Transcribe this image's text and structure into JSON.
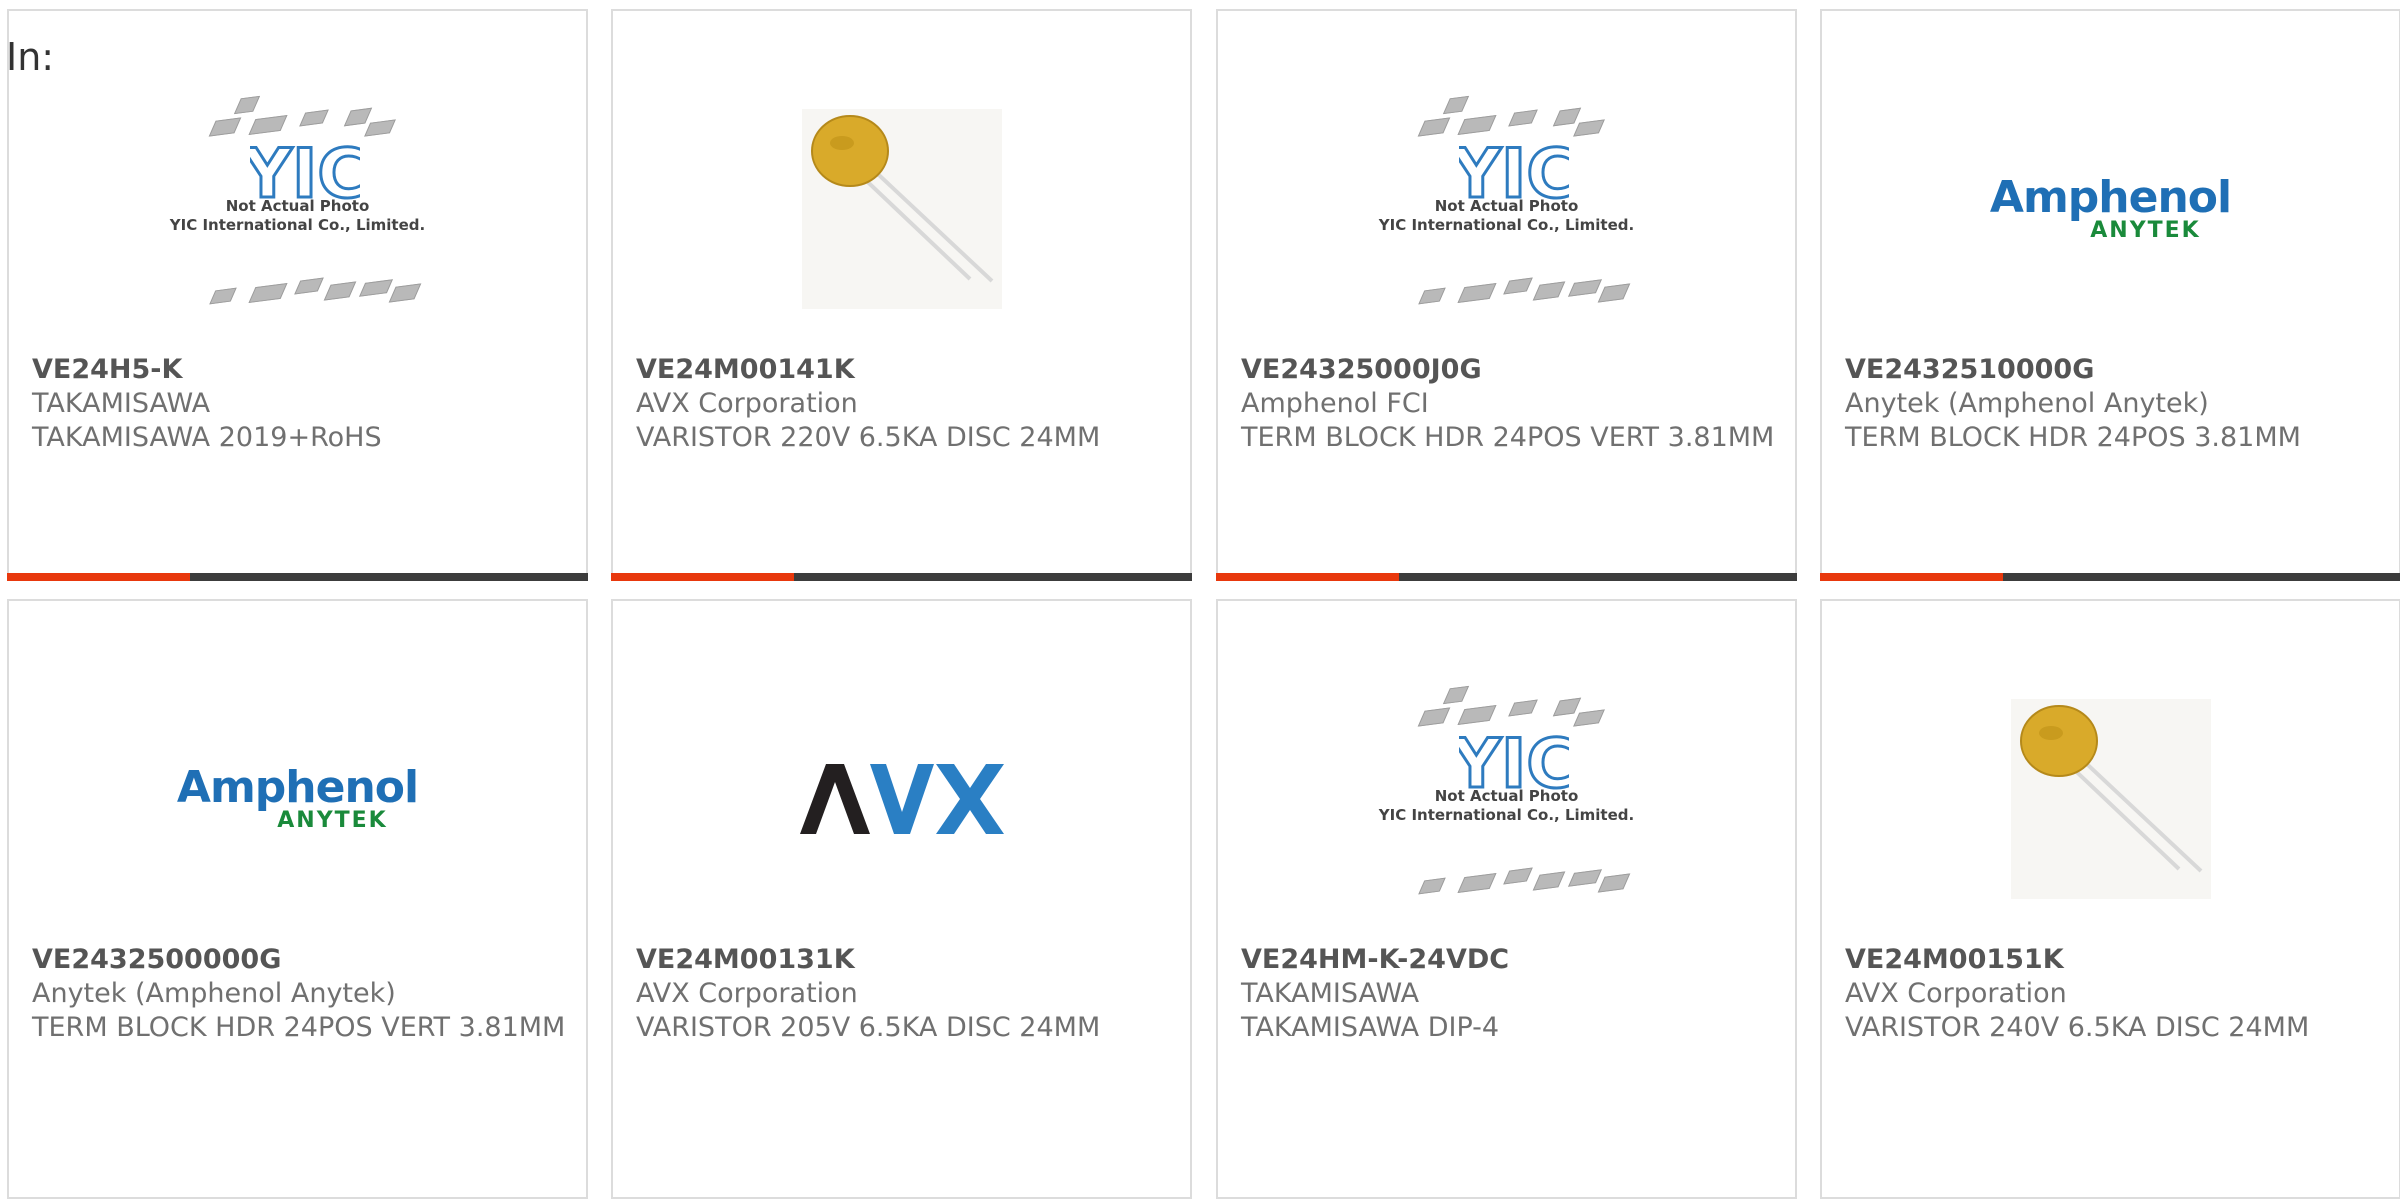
{
  "header": {
    "label": "In:"
  },
  "products": [
    {
      "part_number": "VE24H5-K",
      "manufacturer": "TAKAMISAWA",
      "description": "TAKAMISAWA 2019+RoHS",
      "image": "yic-placeholder"
    },
    {
      "part_number": "VE24M00141K",
      "manufacturer": "AVX Corporation",
      "description": "VARISTOR 220V 6.5KA DISC 24MM",
      "image": "varistor-disc"
    },
    {
      "part_number": "VE24325000J0G",
      "manufacturer": "Amphenol FCI",
      "description": "TERM BLOCK HDR 24POS VERT 3.81MM",
      "image": "yic-placeholder"
    },
    {
      "part_number": "VE2432510000G",
      "manufacturer": "Anytek (Amphenol Anytek)",
      "description": "TERM BLOCK HDR 24POS 3.81MM",
      "image": "amphenol-anytek-logo"
    },
    {
      "part_number": "VE2432500000G",
      "manufacturer": "Anytek (Amphenol Anytek)",
      "description": "TERM BLOCK HDR 24POS VERT 3.81MM",
      "image": "amphenol-anytek-logo"
    },
    {
      "part_number": "VE24M00131K",
      "manufacturer": "AVX Corporation",
      "description": "VARISTOR 205V 6.5KA DISC 24MM",
      "image": "avx-logo"
    },
    {
      "part_number": "VE24HM-K-24VDC",
      "manufacturer": "TAKAMISAWA",
      "description": "TAKAMISAWA DIP-4",
      "image": "yic-placeholder"
    },
    {
      "part_number": "VE24M00151K",
      "manufacturer": "AVX Corporation",
      "description": "VARISTOR 240V 6.5KA DISC 24MM",
      "image": "varistor-disc"
    }
  ],
  "placeholder": {
    "line1": "Not Actual Photo",
    "line2": "YIC International Co., Limited.",
    "logo": "YIC"
  },
  "logos": {
    "amphenol": "Amphenol",
    "anytek": "ANYTEK",
    "avx": "AVX"
  },
  "colors": {
    "accent": "#e8380d",
    "bar": "#3c3c3c",
    "border": "#dcdcdc",
    "amphenol_blue": "#1f6fb5",
    "anytek_green": "#1a8a3b",
    "avx_black": "#231f20",
    "avx_blue": "#2a7fc4"
  }
}
